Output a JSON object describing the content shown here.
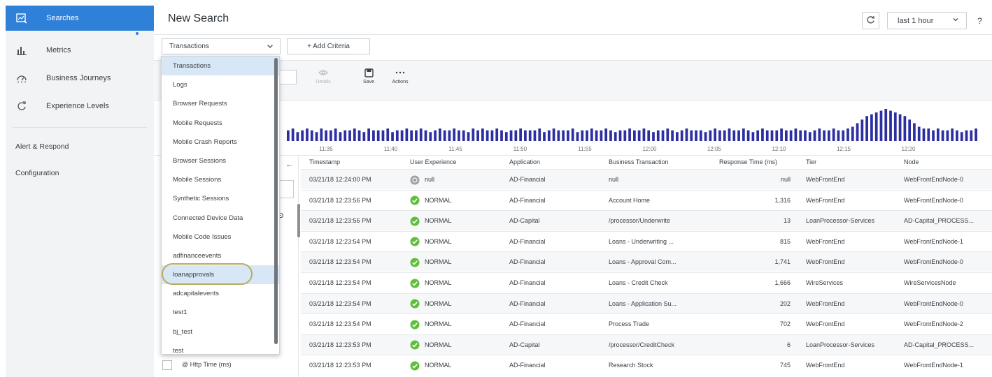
{
  "sidebar": {
    "active": {
      "label": "Searches",
      "icon": "search-analytics-icon"
    },
    "items": [
      {
        "label": "Metrics",
        "icon": "bar-chart-icon"
      },
      {
        "label": "Business Journeys",
        "icon": "gauge-icon"
      },
      {
        "label": "Experience Levels",
        "icon": "refresh-target-icon"
      }
    ],
    "plain": [
      {
        "label": "Alert & Respond"
      },
      {
        "label": "Configuration"
      }
    ]
  },
  "header": {
    "title": "New Search",
    "time_range": "last 1 hour",
    "help": "?"
  },
  "criteria": {
    "type_selected": "Transactions",
    "add_criteria_label": "+ Add Criteria"
  },
  "toolbar": {
    "details_label": "Details",
    "save_label": "Save",
    "actions_label": "Actions"
  },
  "dropdown": {
    "selected": "Transactions",
    "highlighted": "loanapprovals",
    "options": [
      "Transactions",
      "Logs",
      "Browser Requests",
      "Mobile Requests",
      "Mobile Crash Reports",
      "Browser Sessions",
      "Mobile Sessions",
      "Synthetic Sessions",
      "Connected Device Data",
      "Mobile Code Issues",
      "adfinanceevents",
      "loanapprovals",
      "adcapitalevents",
      "test1",
      "bj_test",
      "test"
    ]
  },
  "left_panel": {
    "back_glyph": "←",
    "field_label": "@ Http Time (ms)"
  },
  "histogram": {
    "time_labels": [
      "11:35",
      "11:40",
      "11:45",
      "11:50",
      "11:55",
      "12:00",
      "12:05",
      "12:10",
      "12:15",
      "12:20"
    ],
    "counts": [
      6,
      7,
      5,
      6,
      7,
      6,
      5,
      7,
      6,
      6,
      7,
      5,
      6,
      6,
      7,
      6,
      5,
      7,
      6,
      6,
      6,
      7,
      5,
      6,
      6,
      7,
      6,
      6,
      7,
      6,
      5,
      6,
      7,
      6,
      6,
      7,
      6,
      6,
      5,
      7,
      6,
      7,
      6,
      6,
      7,
      6,
      5,
      6,
      6,
      7,
      6,
      6,
      6,
      7,
      5,
      6,
      7,
      6,
      6,
      6,
      7,
      5,
      6,
      6,
      7,
      6,
      6,
      7,
      6,
      5,
      6,
      6,
      7,
      6,
      6,
      7,
      6,
      5,
      6,
      6,
      7,
      6,
      5,
      6,
      7,
      6,
      6,
      6,
      5,
      6,
      7,
      6,
      6,
      7,
      6,
      6,
      7,
      6,
      5,
      6,
      7,
      6,
      6,
      6,
      7,
      6,
      6,
      7,
      6,
      6,
      5,
      6,
      7,
      6,
      6,
      7,
      6,
      6,
      7,
      8,
      10,
      12,
      14,
      15,
      16,
      17,
      18,
      17,
      16,
      15,
      14,
      12,
      10,
      8,
      7,
      7,
      6,
      7,
      6,
      6,
      7,
      6,
      5,
      6,
      6,
      7
    ]
  },
  "table": {
    "columns": [
      "Timestamp",
      "User Experience",
      "Application",
      "Business Transaction",
      "Response Time (ms)",
      "Tier",
      "Node"
    ],
    "rows": [
      {
        "timestamp": "03/21/18 12:24:00 PM",
        "ux": "null",
        "ux_status": "null",
        "app": "AD-Financial",
        "bt": "null",
        "rt": "null",
        "tier": "WebFrontEnd",
        "node": "WebFrontEndNode-0"
      },
      {
        "timestamp": "03/21/18 12:23:56 PM",
        "ux": "NORMAL",
        "ux_status": "normal",
        "app": "AD-Financial",
        "bt": "Account Home",
        "rt": "1,316",
        "tier": "WebFrontEnd",
        "node": "WebFrontEndNode-0"
      },
      {
        "timestamp": "03/21/18 12:23:56 PM",
        "ux": "NORMAL",
        "ux_status": "normal",
        "app": "AD-Capital",
        "bt": "/processor/Underwrite",
        "rt": "13",
        "tier": "LoanProcessor-Services",
        "node": "AD-Capital_PROCESS..."
      },
      {
        "timestamp": "03/21/18 12:23:54 PM",
        "ux": "NORMAL",
        "ux_status": "normal",
        "app": "AD-Financial",
        "bt": "Loans - Underwriting ...",
        "rt": "815",
        "tier": "WebFrontEnd",
        "node": "WebFrontEndNode-1"
      },
      {
        "timestamp": "03/21/18 12:23:54 PM",
        "ux": "NORMAL",
        "ux_status": "normal",
        "app": "AD-Financial",
        "bt": "Loans - Approval Com...",
        "rt": "1,741",
        "tier": "WebFrontEnd",
        "node": "WebFrontEndNode-0"
      },
      {
        "timestamp": "03/21/18 12:23:54 PM",
        "ux": "NORMAL",
        "ux_status": "normal",
        "app": "AD-Financial",
        "bt": "Loans - Credit Check",
        "rt": "1,666",
        "tier": "WireServices",
        "node": "WireServicesNode"
      },
      {
        "timestamp": "03/21/18 12:23:54 PM",
        "ux": "NORMAL",
        "ux_status": "normal",
        "app": "AD-Financial",
        "bt": "Loans - Application Su...",
        "rt": "202",
        "tier": "WebFrontEnd",
        "node": "WebFrontEndNode-0"
      },
      {
        "timestamp": "03/21/18 12:23:54 PM",
        "ux": "NORMAL",
        "ux_status": "normal",
        "app": "AD-Financial",
        "bt": "Process Trade",
        "rt": "702",
        "tier": "WebFrontEnd",
        "node": "WebFrontEndNode-2"
      },
      {
        "timestamp": "03/21/18 12:23:53 PM",
        "ux": "NORMAL",
        "ux_status": "normal",
        "app": "AD-Capital",
        "bt": "/processor/CreditCheck",
        "rt": "6",
        "tier": "LoanProcessor-Services",
        "node": "AD-Capital_PROCESS..."
      },
      {
        "timestamp": "03/21/18 12:23:53 PM",
        "ux": "NORMAL",
        "ux_status": "normal",
        "app": "AD-Financial",
        "bt": "Research Stock",
        "rt": "745",
        "tier": "WebFrontEnd",
        "node": "WebFrontEndNode-1"
      }
    ]
  },
  "colors": {
    "accent": "#2f80d9",
    "bars": "#2b2fa0",
    "normal_status": "#5fbf3c",
    "null_status": "#9aa0a6",
    "highlight_ring": "#b9ad5a"
  }
}
